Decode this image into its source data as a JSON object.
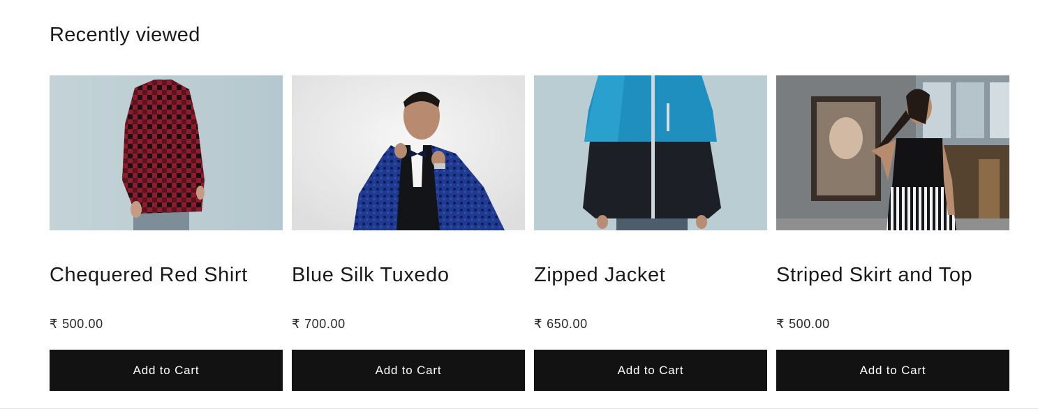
{
  "section": {
    "title": "Recently viewed"
  },
  "products": [
    {
      "title": "Chequered Red Shirt",
      "currency": "₹",
      "price": "500.00",
      "button_label": "Add to Cart"
    },
    {
      "title": "Blue Silk Tuxedo",
      "currency": "₹",
      "price": "700.00",
      "button_label": "Add to Cart"
    },
    {
      "title": "Zipped Jacket",
      "currency": "₹",
      "price": "650.00",
      "button_label": "Add to Cart"
    },
    {
      "title": "Striped Skirt and Top",
      "currency": "₹",
      "price": "500.00",
      "button_label": "Add to Cart"
    }
  ],
  "colors": {
    "button_bg": "#121212",
    "button_text": "#ffffff",
    "text": "#121212"
  }
}
